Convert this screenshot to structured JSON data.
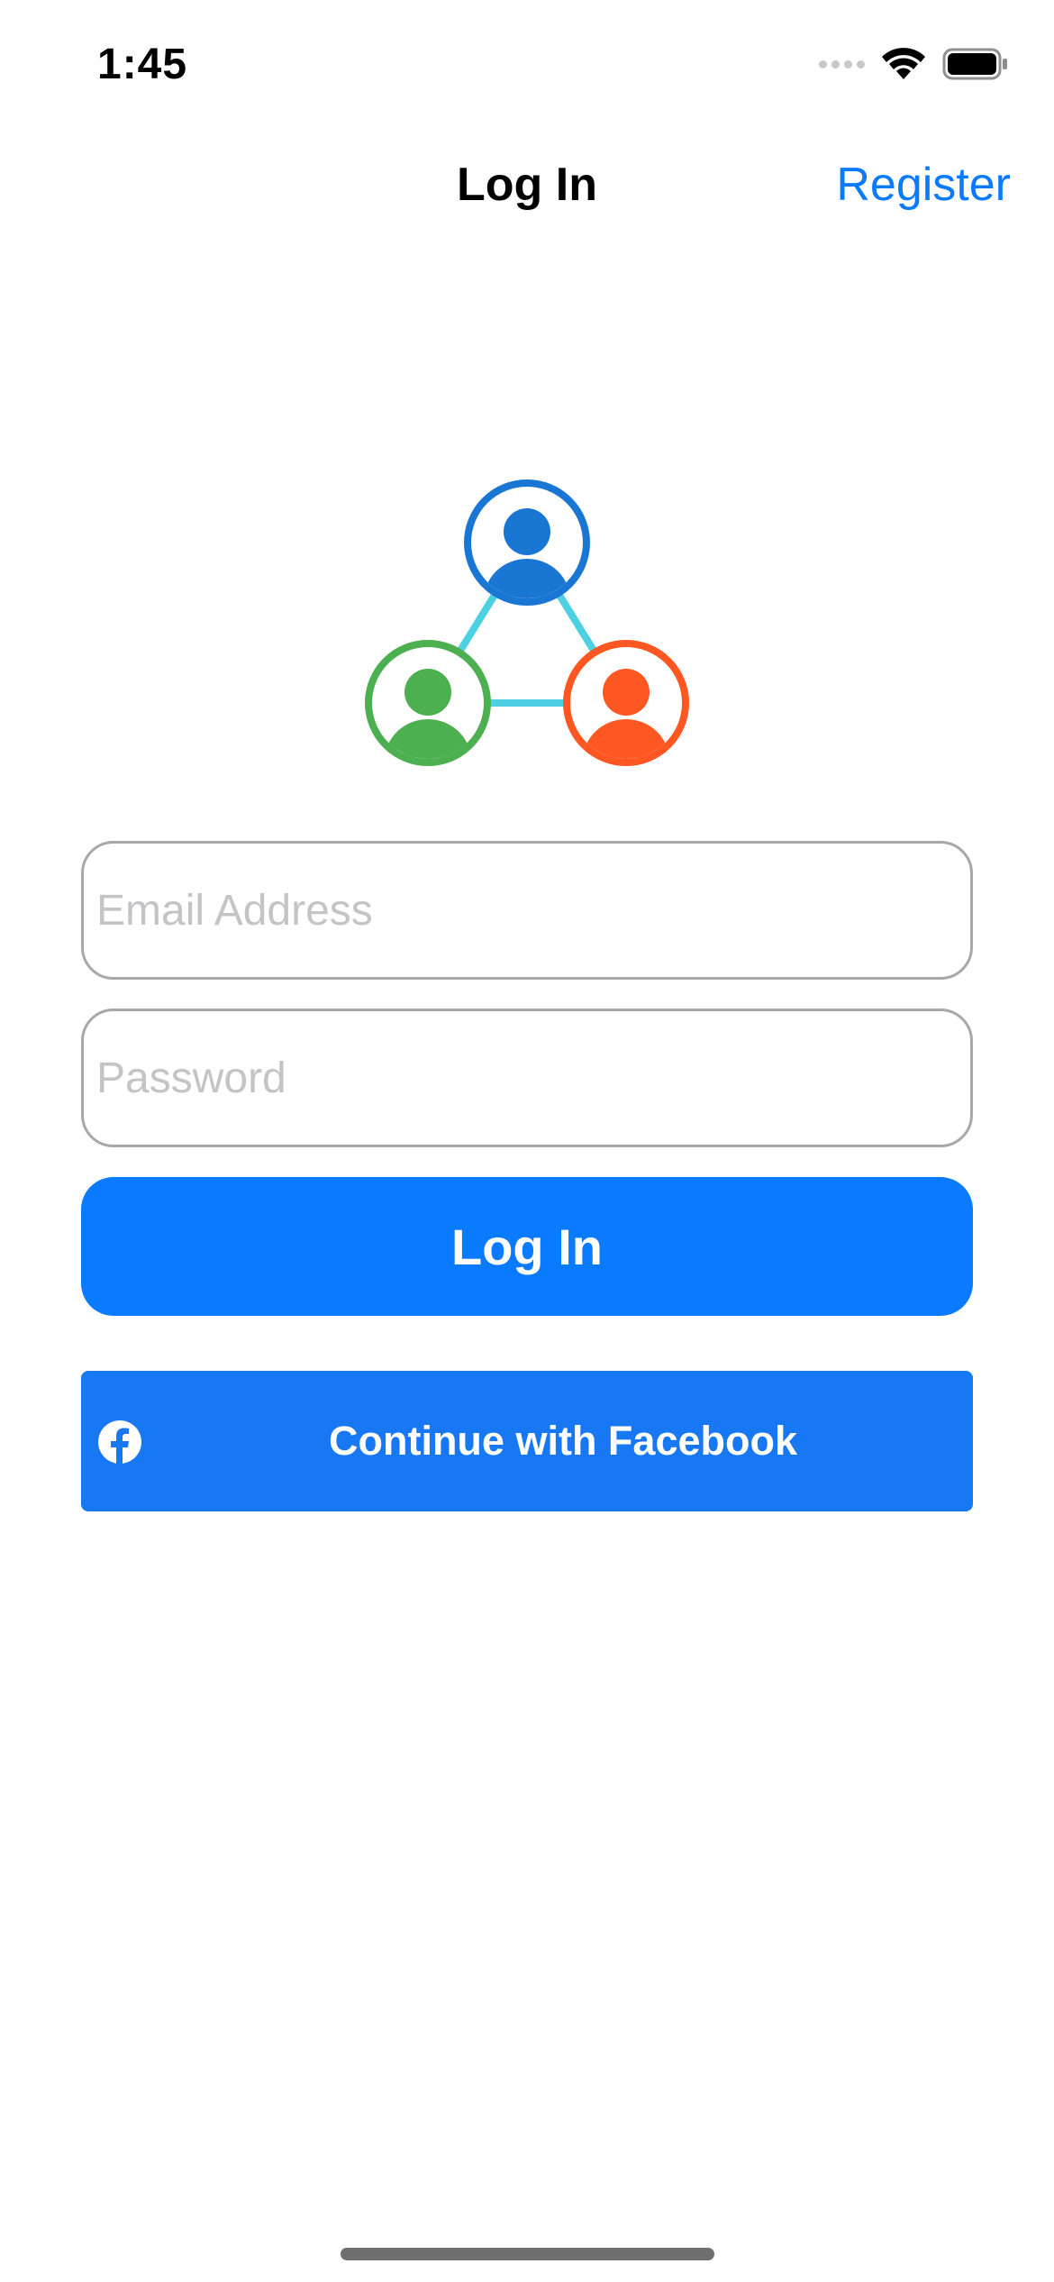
{
  "status_bar": {
    "time": "1:45"
  },
  "nav": {
    "title": "Log In",
    "register_label": "Register"
  },
  "form": {
    "email_placeholder": "Email Address",
    "email_value": "",
    "password_placeholder": "Password",
    "password_value": "",
    "login_label": "Log In",
    "facebook_label": "Continue with Facebook"
  },
  "colors": {
    "accent": "#0a7aff",
    "facebook": "#1877f2",
    "logo_blue": "#1976d2",
    "logo_green": "#4caf50",
    "logo_orange": "#ff5722",
    "logo_connector": "#4dd0e1"
  },
  "icons": {
    "logo": "people-network-icon",
    "facebook": "facebook-icon",
    "wifi": "wifi-icon",
    "battery": "battery-icon",
    "signal": "cellular-signal-icon"
  }
}
